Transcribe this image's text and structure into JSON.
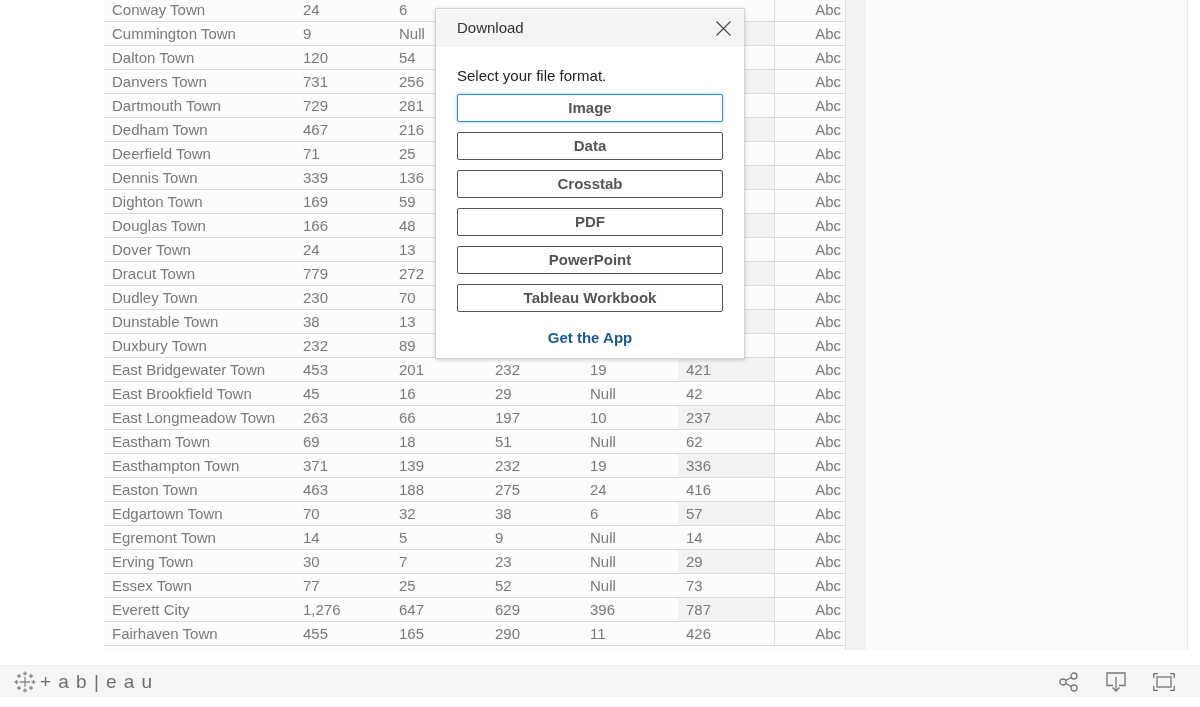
{
  "table": {
    "rows": [
      {
        "name": "Conway Town",
        "column_2": "24",
        "column_3": "6",
        "column_7": "Abc"
      },
      {
        "name": "Cummington Town",
        "column_2": "9",
        "column_3": "Null",
        "column_7": "Abc"
      },
      {
        "name": "Dalton Town",
        "column_2": "120",
        "column_3": "54",
        "column_7": "Abc"
      },
      {
        "name": "Danvers Town",
        "column_2": "731",
        "column_3": "256",
        "column_7": "Abc"
      },
      {
        "name": "Dartmouth Town",
        "column_2": "729",
        "column_3": "281",
        "column_7": "Abc"
      },
      {
        "name": "Dedham Town",
        "column_2": "467",
        "column_3": "216",
        "column_7": "Abc"
      },
      {
        "name": "Deerfield Town",
        "column_2": "71",
        "column_3": "25",
        "column_7": "Abc"
      },
      {
        "name": "Dennis Town",
        "column_2": "339",
        "column_3": "136",
        "column_7": "Abc"
      },
      {
        "name": "Dighton Town",
        "column_2": "169",
        "column_3": "59",
        "column_7": "Abc"
      },
      {
        "name": "Douglas Town",
        "column_2": "166",
        "column_3": "48",
        "column_7": "Abc"
      },
      {
        "name": "Dover Town",
        "column_2": "24",
        "column_3": "13",
        "column_7": "Abc"
      },
      {
        "name": "Dracut Town",
        "column_2": "779",
        "column_3": "272",
        "column_7": "Abc"
      },
      {
        "name": "Dudley Town",
        "column_2": "230",
        "column_3": "70",
        "column_7": "Abc"
      },
      {
        "name": "Dunstable Town",
        "column_2": "38",
        "column_3": "13",
        "column_7": "Abc"
      },
      {
        "name": "Duxbury Town",
        "column_2": "232",
        "column_3": "89",
        "column_7": "Abc"
      },
      {
        "name": "East Bridgewater Town",
        "column_2": "453",
        "column_3": "201",
        "column_4": "232",
        "column_5": "19",
        "column_6": "421",
        "column_7": "Abc"
      },
      {
        "name": "East Brookfield Town",
        "column_2": "45",
        "column_3": "16",
        "column_4": "29",
        "column_5": "Null",
        "column_6": "42",
        "column_7": "Abc"
      },
      {
        "name": "East Longmeadow Town",
        "column_2": "263",
        "column_3": "66",
        "column_4": "197",
        "column_5": "10",
        "column_6": "237",
        "column_7": "Abc"
      },
      {
        "name": "Eastham Town",
        "column_2": "69",
        "column_3": "18",
        "column_4": "51",
        "column_5": "Null",
        "column_6": "62",
        "column_7": "Abc"
      },
      {
        "name": "Easthampton Town",
        "column_2": "371",
        "column_3": "139",
        "column_4": "232",
        "column_5": "19",
        "column_6": "336",
        "column_7": "Abc"
      },
      {
        "name": "Easton Town",
        "column_2": "463",
        "column_3": "188",
        "column_4": "275",
        "column_5": "24",
        "column_6": "416",
        "column_7": "Abc"
      },
      {
        "name": "Edgartown Town",
        "column_2": "70",
        "column_3": "32",
        "column_4": "38",
        "column_5": "6",
        "column_6": "57",
        "column_7": "Abc"
      },
      {
        "name": "Egremont Town",
        "column_2": "14",
        "column_3": "5",
        "column_4": "9",
        "column_5": "Null",
        "column_6": "14",
        "column_7": "Abc"
      },
      {
        "name": "Erving Town",
        "column_2": "30",
        "column_3": "7",
        "column_4": "23",
        "column_5": "Null",
        "column_6": "29",
        "column_7": "Abc"
      },
      {
        "name": "Essex Town",
        "column_2": "77",
        "column_3": "25",
        "column_4": "52",
        "column_5": "Null",
        "column_6": "73",
        "column_7": "Abc"
      },
      {
        "name": "Everett City",
        "column_2": "1,276",
        "column_3": "647",
        "column_4": "629",
        "column_5": "396",
        "column_6": "787",
        "column_7": "Abc"
      },
      {
        "name": "Fairhaven Town",
        "column_2": "455",
        "column_3": "165",
        "column_4": "290",
        "column_5": "11",
        "column_6": "426",
        "column_7": "Abc"
      }
    ]
  },
  "dialog": {
    "title": "Download",
    "prompt": "Select your file format.",
    "options": [
      {
        "label": "Image",
        "focused": true
      },
      {
        "label": "Data",
        "focused": false
      },
      {
        "label": "Crosstab",
        "focused": false
      },
      {
        "label": "PDF",
        "focused": false
      },
      {
        "label": "PowerPoint",
        "focused": false
      },
      {
        "label": "Tableau Workbook",
        "focused": false
      }
    ],
    "link": "Get the App"
  },
  "toolbar": {
    "logo_wordmark": "+ab|eau"
  }
}
